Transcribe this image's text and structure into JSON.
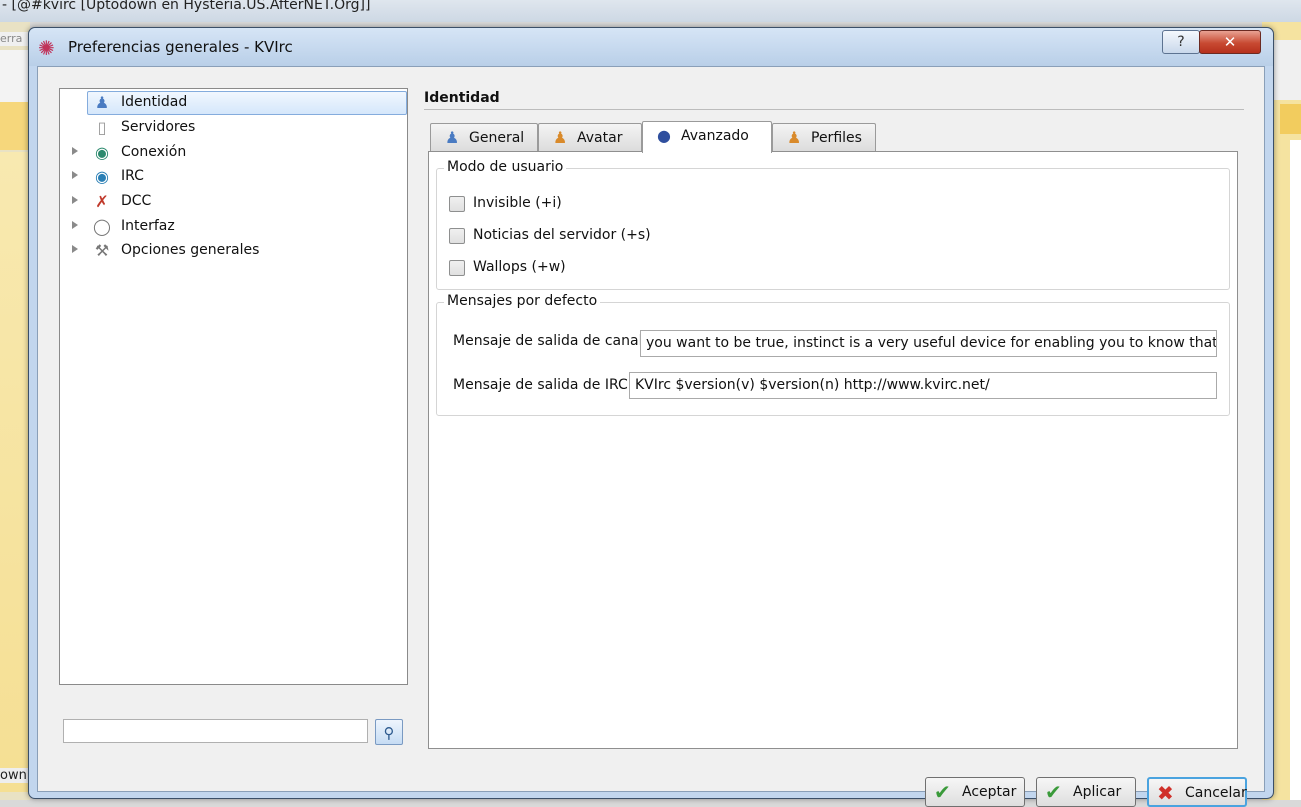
{
  "background": {
    "window_title": "- [@#kvirc [Uptodown en Hysteria.US.AfterNET.Org]]",
    "left_fragment_1": "erra",
    "left_fragment_2": "own"
  },
  "dialog": {
    "title": "Preferencias generales - KVIrc",
    "help_symbol": "?",
    "close_symbol": "✕"
  },
  "tree": {
    "items": [
      {
        "label": "Identidad",
        "icon": "user-icon"
      },
      {
        "label": "Servidores",
        "icon": "server-icon"
      },
      {
        "label": "Conexión",
        "icon": "globe-icon"
      },
      {
        "label": "IRC",
        "icon": "irc-icon"
      },
      {
        "label": "DCC",
        "icon": "dcc-icon"
      },
      {
        "label": "Interfaz",
        "icon": "lightbulb-icon"
      },
      {
        "label": "Opciones generales",
        "icon": "wrench-icon"
      }
    ]
  },
  "section": {
    "title": "Identidad"
  },
  "tabs": [
    {
      "label": "General",
      "icon": "person-icon"
    },
    {
      "label": "Avatar",
      "icon": "avatar-icon"
    },
    {
      "label": "Avanzado",
      "icon": "advanced-icon"
    },
    {
      "label": "Perfiles",
      "icon": "profiles-icon"
    }
  ],
  "modo_usuario": {
    "legend": "Modo de usuario",
    "options": [
      {
        "label": "Invisible (+i)",
        "checked": false
      },
      {
        "label": "Noticias del servidor (+s)",
        "checked": false
      },
      {
        "label": "Wallops (+w)",
        "checked": false
      }
    ]
  },
  "mensajes": {
    "legend": "Mensajes por defecto",
    "canal_label": "Mensaje de salida de canal:",
    "canal_value": "you want to be true, instinct is a very useful device for enabling you to know that it is",
    "irc_label": "Mensaje de salida de IRC:",
    "irc_value": "KVIrc $version(v) $version(n) http://www.kvirc.net/"
  },
  "buttons": {
    "aceptar": "Aceptar",
    "aplicar": "Aplicar",
    "cancelar": "Cancelar"
  },
  "colors": {
    "accent": "#4aa3df",
    "selection": "#d5e7fb"
  }
}
